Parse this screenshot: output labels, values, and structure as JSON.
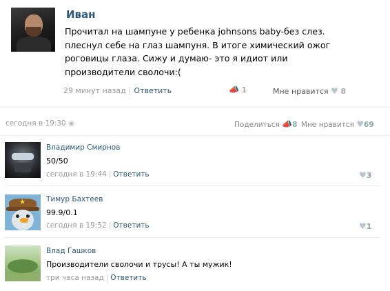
{
  "post": {
    "author": "Иван",
    "text_lines": [
      "Прочитал на шампуне у ребенка johnsons baby-без слез.",
      "плеснул себе на глаз шампуня. В итоге химический ожог",
      "роговицы глаза. Сижу и думаю- это я идиот или",
      "производители сволочи:("
    ],
    "time": "29 минут назад",
    "reply_label": "Ответить",
    "share_count": "1",
    "like_label": "Мне нравится",
    "like_count": "8"
  },
  "bar": {
    "date": "сегодня в 19:30",
    "share_label": "Поделиться",
    "share_count": "8",
    "like_label": "Мне нравится",
    "like_count": "69"
  },
  "comments": [
    {
      "author": "Владимир Смирнов",
      "text": "50/50",
      "time": "сегодня в 19:44",
      "reply_label": "Ответить",
      "likes": "3",
      "avatar": "helmet-avatar"
    },
    {
      "author": "Тимур Бахтеев",
      "text": "99.9/0.1",
      "time": "сегодня в 19:52",
      "reply_label": "Ответить",
      "likes": "1",
      "avatar": "cowboy-bird-avatar"
    },
    {
      "author": "Влад Гашков",
      "text": "Производители сволочи и трусы! А ты мужик!",
      "time": "три часа назад",
      "reply_label": "Ответить",
      "likes": "",
      "avatar": "nature-avatar"
    }
  ],
  "colors": {
    "link": "#2b587a",
    "meta": "#999999",
    "divider": "#e7eaed"
  },
  "icons": {
    "megaphone": "megaphone-icon",
    "heart": "heart-icon",
    "camera": "camera-icon"
  }
}
